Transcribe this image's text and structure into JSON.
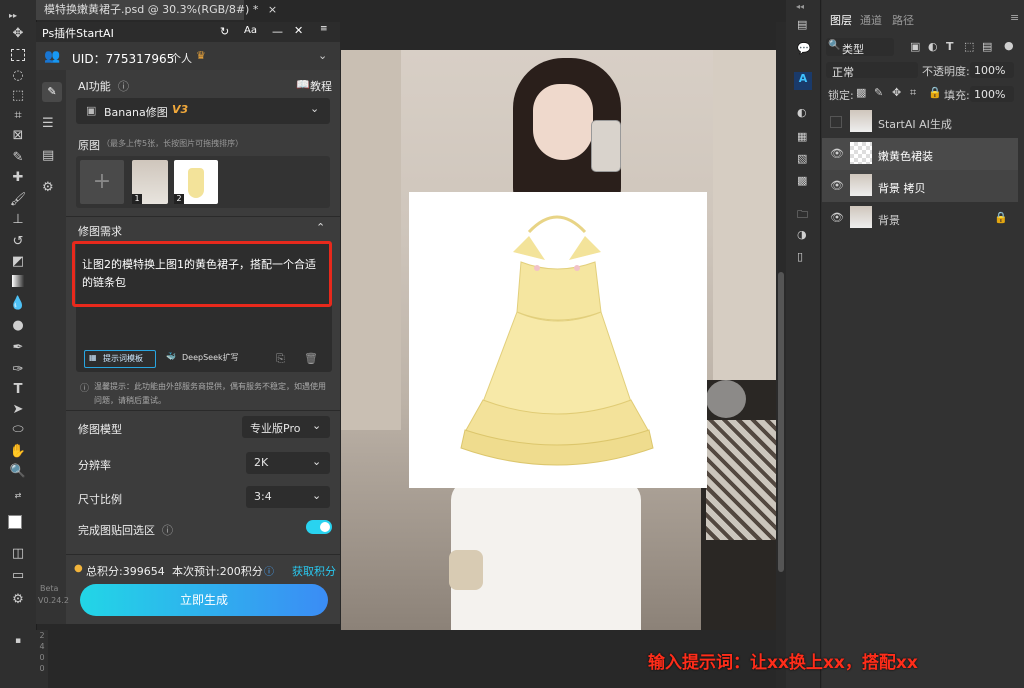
{
  "document_tab": {
    "title": "模特换嫩黄裙子.psd @ 30.3%(RGB/8#) *",
    "close": "×"
  },
  "plugin": {
    "title": "Ps插件StartAI",
    "header_icons": [
      "refresh-icon",
      "font-size-icon",
      "minimize-icon",
      "close-icon"
    ],
    "uid_label": "UID：775317965",
    "account_type": "个人",
    "ai_function_label": "AI功能",
    "tutorial_label": "教程",
    "function_selected": "Banana修图",
    "function_version": "V3",
    "original_label": "原图",
    "original_hint": "（最多上传5张，长按图片可拖拽排序）",
    "thumb1_index": "1",
    "thumb2_index": "2",
    "requirement_label": "修图需求",
    "prompt_text": "让图2的模特换上图1的黄色裙子，搭配一个合适的链条包",
    "prompt_template_btn": "提示词模板",
    "deepseek_btn": "DeepSeek扩写",
    "warning_text": "温馨提示：此功能由外部服务商提供，偶有服务不稳定，如遇使用问题，请稍后重试。",
    "model_label": "修图模型",
    "model_value": "专业版Pro",
    "resolution_label": "分辨率",
    "resolution_value": "2K",
    "ratio_label": "尺寸比例",
    "ratio_value": "3:4",
    "paste_back_label": "完成图贴回选区",
    "paste_back_on": true,
    "points_total": "总积分:399654",
    "points_estimate": "本次预计:200积分",
    "get_points": "获取积分",
    "generate_btn": "立即生成",
    "beta_label": "Beta",
    "version_label": "V0.24.2"
  },
  "layers_panel": {
    "tabs": [
      "图层",
      "通道",
      "路径"
    ],
    "kind_filter": "类型",
    "blend_mode": "正常",
    "opacity_label": "不透明度:",
    "opacity_value": "100%",
    "lock_label": "锁定:",
    "fill_label": "填充:",
    "fill_value": "100%",
    "layers": [
      {
        "name": "StartAI AI生成",
        "visible": false
      },
      {
        "name": "嫩黄色裙装",
        "visible": true
      },
      {
        "name": "背景 拷贝",
        "visible": true
      },
      {
        "name": "背景",
        "visible": true,
        "locked": true
      }
    ]
  },
  "ruler_numbers": [
    "2",
    "4",
    "0",
    "0"
  ],
  "caption": "输入提示词：让xx换上xx，搭配xx",
  "colors": {
    "accent_cyan": "#29d3f0",
    "highlight_red": "#e8291c",
    "caption_red": "#ff2d1a",
    "panel_bg": "#3c3c3c"
  }
}
